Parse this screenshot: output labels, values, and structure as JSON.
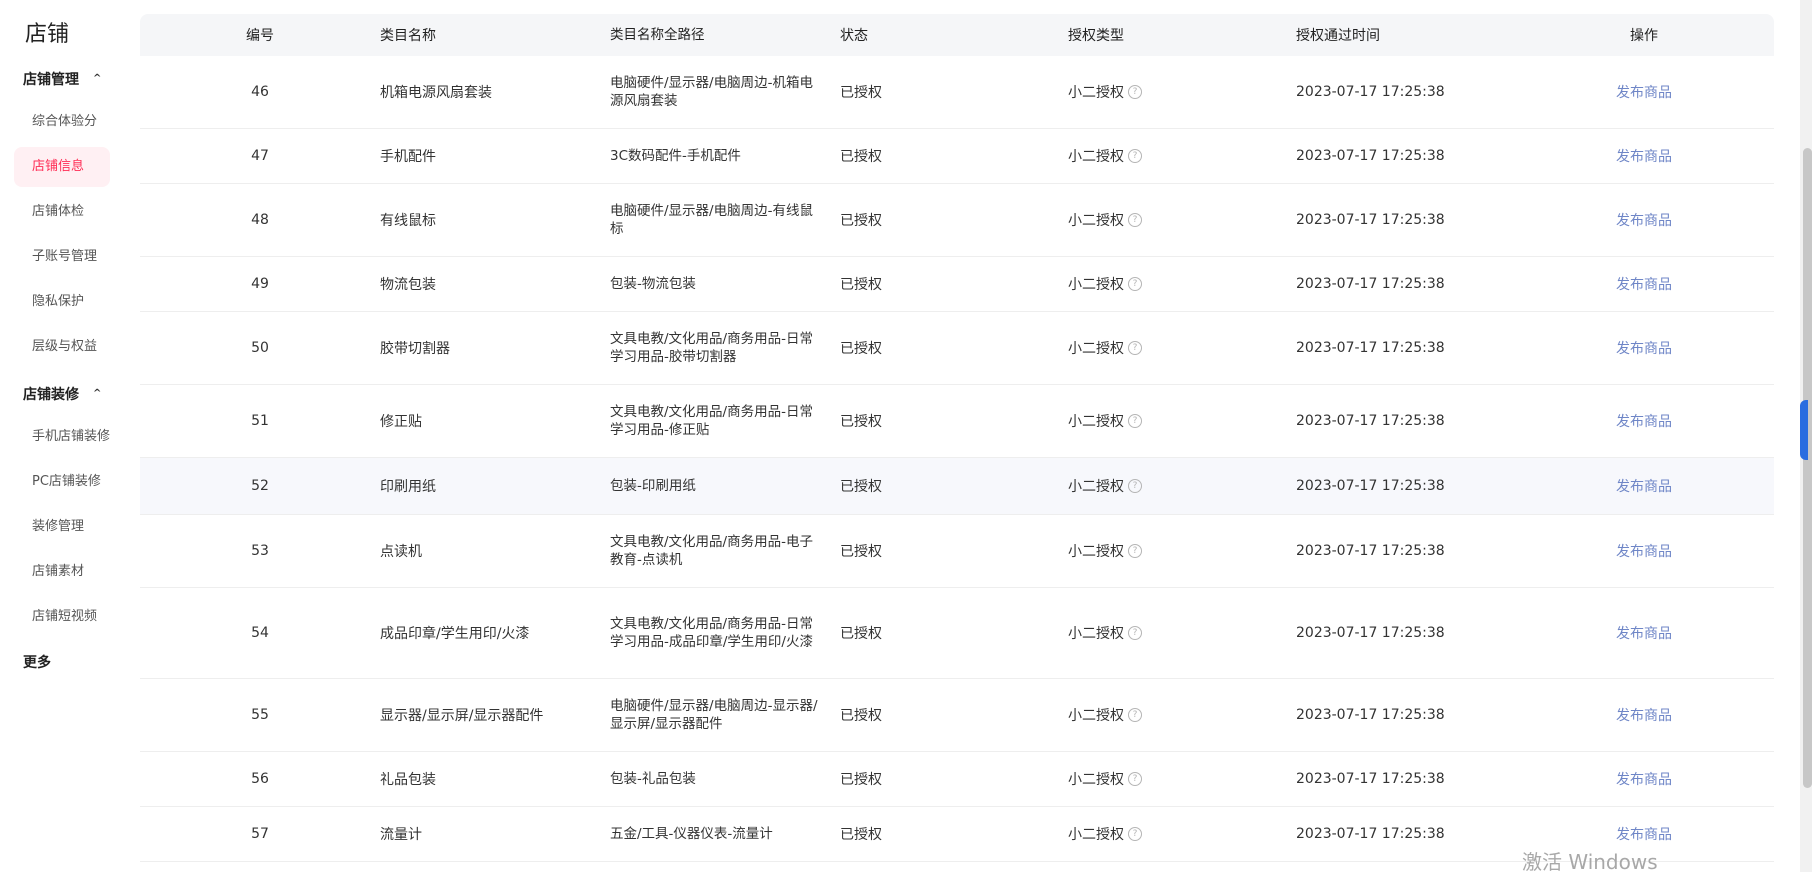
{
  "sidebar": {
    "title": "店铺",
    "groups": [
      {
        "label": "店铺管理",
        "items": [
          "综合体验分",
          "店铺信息",
          "店铺体检",
          "子账号管理",
          "隐私保护",
          "层级与权益"
        ]
      },
      {
        "label": "店铺装修",
        "items": [
          "手机店铺装修",
          "PC店铺装修",
          "装修管理",
          "店铺素材",
          "店铺短视频"
        ]
      }
    ],
    "more": "更多",
    "chevron": "^"
  },
  "table": {
    "headers": [
      "编号",
      "类目名称",
      "类目名称全路径",
      "状态",
      "授权类型",
      "授权通过时间",
      "操作"
    ],
    "rows": [
      {
        "no": "46",
        "name": "机箱电源风扇套装",
        "path": "电脑硬件/显示器/电脑周边-机箱电源风扇套装",
        "status": "已授权",
        "type": "小二授权",
        "time": "2023-07-17 17:25:38",
        "op": "发布商品"
      },
      {
        "no": "47",
        "name": "手机配件",
        "path": "3C数码配件-手机配件",
        "status": "已授权",
        "type": "小二授权",
        "time": "2023-07-17 17:25:38",
        "op": "发布商品"
      },
      {
        "no": "48",
        "name": "有线鼠标",
        "path": "电脑硬件/显示器/电脑周边-有线鼠标",
        "status": "已授权",
        "type": "小二授权",
        "time": "2023-07-17 17:25:38",
        "op": "发布商品"
      },
      {
        "no": "49",
        "name": "物流包装",
        "path": "包装-物流包装",
        "status": "已授权",
        "type": "小二授权",
        "time": "2023-07-17 17:25:38",
        "op": "发布商品"
      },
      {
        "no": "50",
        "name": "胶带切割器",
        "path": "文具电教/文化用品/商务用品-日常学习用品-胶带切割器",
        "status": "已授权",
        "type": "小二授权",
        "time": "2023-07-17 17:25:38",
        "op": "发布商品"
      },
      {
        "no": "51",
        "name": "修正贴",
        "path": "文具电教/文化用品/商务用品-日常学习用品-修正贴",
        "status": "已授权",
        "type": "小二授权",
        "time": "2023-07-17 17:25:38",
        "op": "发布商品"
      },
      {
        "no": "52",
        "name": "印刷用纸",
        "path": "包装-印刷用纸",
        "status": "已授权",
        "type": "小二授权",
        "time": "2023-07-17 17:25:38",
        "op": "发布商品"
      },
      {
        "no": "53",
        "name": "点读机",
        "path": "文具电教/文化用品/商务用品-电子教育-点读机",
        "status": "已授权",
        "type": "小二授权",
        "time": "2023-07-17 17:25:38",
        "op": "发布商品"
      },
      {
        "no": "54",
        "name": "成品印章/学生用印/火漆",
        "path": "文具电教/文化用品/商务用品-日常学习用品-成品印章/学生用印/火漆",
        "status": "已授权",
        "type": "小二授权",
        "time": "2023-07-17 17:25:38",
        "op": "发布商品"
      },
      {
        "no": "55",
        "name": "显示器/显示屏/显示器配件",
        "path": "电脑硬件/显示器/电脑周边-显示器/显示屏/显示器配件",
        "status": "已授权",
        "type": "小二授权",
        "time": "2023-07-17 17:25:38",
        "op": "发布商品"
      },
      {
        "no": "56",
        "name": "礼品包装",
        "path": "包装-礼品包装",
        "status": "已授权",
        "type": "小二授权",
        "time": "2023-07-17 17:25:38",
        "op": "发布商品"
      },
      {
        "no": "57",
        "name": "流量计",
        "path": "五金/工具-仪器仪表-流量计",
        "status": "已授权",
        "type": "小二授权",
        "time": "2023-07-17 17:25:38",
        "op": "发布商品"
      }
    ],
    "help_glyph": "?"
  },
  "watermark": "激活 Windows"
}
